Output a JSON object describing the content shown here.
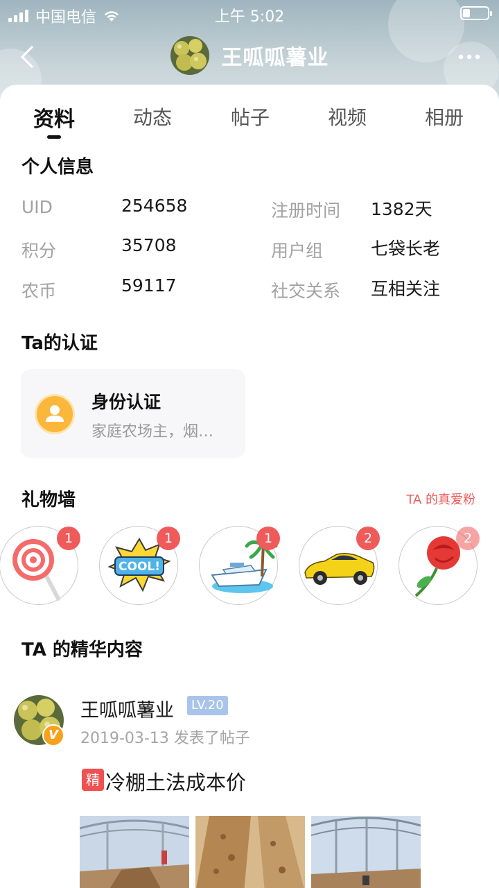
{
  "status_bar": {
    "carrier": "中国电信",
    "time": "上午 5:02"
  },
  "nav": {
    "title": "王呱呱薯业"
  },
  "tabs": [
    {
      "label": "资料",
      "active": true
    },
    {
      "label": "动态",
      "active": false
    },
    {
      "label": "帖子",
      "active": false
    },
    {
      "label": "视频",
      "active": false
    },
    {
      "label": "相册",
      "active": false
    }
  ],
  "personal_info": {
    "title": "个人信息",
    "left": [
      {
        "label": "UID",
        "value": "254658"
      },
      {
        "label": "积分",
        "value": "35708"
      },
      {
        "label": "农币",
        "value": "59117"
      }
    ],
    "right": [
      {
        "label": "注册时间",
        "value": "1382天"
      },
      {
        "label": "用户组",
        "value": "七袋长老"
      },
      {
        "label": "社交关系",
        "value": "互相关注"
      }
    ]
  },
  "certification": {
    "title": "Ta的认证",
    "card_title": "身份认证",
    "card_desc": "家庭农场主，烟…"
  },
  "gift_wall": {
    "title": "礼物墙",
    "fans_link": "TA 的真爱粉",
    "gifts": [
      {
        "icon": "lollipop-icon",
        "count": "1"
      },
      {
        "icon": "cool-sticker-icon",
        "count": "1"
      },
      {
        "icon": "yacht-icon",
        "count": "1"
      },
      {
        "icon": "sports-car-icon",
        "count": "2"
      },
      {
        "icon": "rose-icon",
        "count": "2"
      }
    ]
  },
  "featured": {
    "title": "TA 的精华内容",
    "post": {
      "author": "王呱呱薯业",
      "level": "LV.20",
      "verified_mark": "V",
      "meta": "2019-03-13 发表了帖子",
      "tag": "精",
      "title": "冷棚土法成本价"
    }
  },
  "colors": {
    "accent_red": "#ef5a5a",
    "level_badge": "#a9c4ea",
    "verified_orange": "#f7a21c"
  }
}
